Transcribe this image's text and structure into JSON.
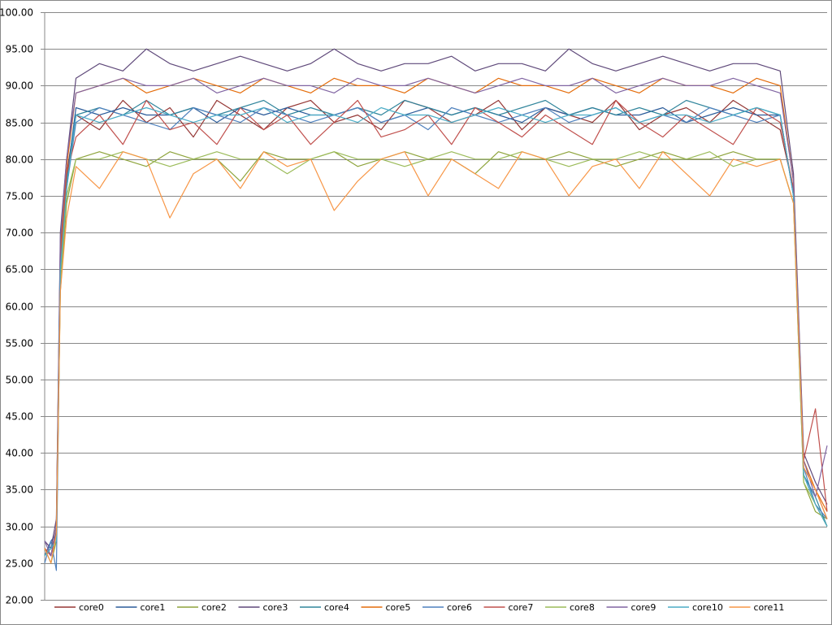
{
  "chart_data": {
    "type": "line",
    "title": "",
    "xlabel": "",
    "ylabel": "",
    "ylim": [
      20,
      100
    ],
    "yticks": [
      "20.00",
      "25.00",
      "30.00",
      "35.00",
      "40.00",
      "45.00",
      "50.00",
      "55.00",
      "60.00",
      "65.00",
      "70.00",
      "75.00",
      "80.00",
      "85.00",
      "90.00",
      "95.00",
      "100.00"
    ],
    "xlim": [
      0,
      1000
    ],
    "grid": true,
    "legend": "bottom",
    "x": [
      0,
      8,
      15,
      20,
      28,
      40,
      70,
      100,
      130,
      160,
      190,
      220,
      250,
      280,
      310,
      340,
      370,
      400,
      430,
      460,
      490,
      520,
      550,
      580,
      610,
      640,
      670,
      700,
      730,
      760,
      790,
      820,
      850,
      880,
      910,
      940,
      957,
      970,
      985,
      1000
    ],
    "series": [
      {
        "name": "core0",
        "color": "#953735",
        "values": [
          27,
          26,
          30,
          68,
          78,
          86,
          84,
          88,
          85,
          87,
          83,
          88,
          86,
          84,
          87,
          88,
          85,
          86,
          84,
          88,
          87,
          85,
          86,
          88,
          84,
          87,
          86,
          85,
          88,
          84,
          86,
          87,
          85,
          88,
          86,
          84,
          76,
          38,
          35,
          31
        ]
      },
      {
        "name": "core1",
        "color": "#2C5C9A",
        "values": [
          26,
          28,
          29,
          66,
          77,
          87,
          86,
          87,
          86,
          86,
          87,
          85,
          87,
          86,
          87,
          86,
          86,
          87,
          85,
          86,
          87,
          86,
          87,
          86,
          85,
          87,
          86,
          87,
          86,
          86,
          87,
          85,
          86,
          87,
          86,
          86,
          75,
          37,
          33,
          30
        ]
      },
      {
        "name": "core2",
        "color": "#8EA43C",
        "values": [
          27,
          25,
          28,
          62,
          74,
          80,
          81,
          80,
          79,
          81,
          80,
          80,
          77,
          81,
          80,
          80,
          81,
          79,
          80,
          81,
          80,
          80,
          78,
          81,
          80,
          80,
          81,
          80,
          79,
          80,
          81,
          80,
          80,
          81,
          80,
          80,
          74,
          36,
          32,
          31
        ]
      },
      {
        "name": "core3",
        "color": "#5F497A",
        "values": [
          28,
          27,
          31,
          70,
          80,
          91,
          93,
          92,
          95,
          93,
          92,
          93,
          94,
          93,
          92,
          93,
          95,
          93,
          92,
          93,
          93,
          94,
          92,
          93,
          93,
          92,
          95,
          93,
          92,
          93,
          94,
          93,
          92,
          93,
          93,
          92,
          78,
          40,
          36,
          33
        ]
      },
      {
        "name": "core4",
        "color": "#31859C",
        "values": [
          26,
          27,
          29,
          65,
          77,
          86,
          87,
          86,
          88,
          86,
          87,
          86,
          87,
          88,
          86,
          87,
          86,
          87,
          86,
          88,
          87,
          86,
          87,
          86,
          87,
          88,
          86,
          87,
          86,
          87,
          86,
          88,
          87,
          86,
          87,
          86,
          75,
          37,
          34,
          30
        ]
      },
      {
        "name": "core5",
        "color": "#E46C0A",
        "values": [
          27,
          26,
          30,
          67,
          79,
          89,
          90,
          91,
          89,
          90,
          91,
          90,
          89,
          91,
          90,
          89,
          91,
          90,
          90,
          89,
          91,
          90,
          89,
          91,
          90,
          90,
          89,
          91,
          90,
          89,
          91,
          90,
          90,
          89,
          91,
          90,
          77,
          39,
          35,
          32
        ]
      },
      {
        "name": "core6",
        "color": "#4F81BD",
        "values": [
          25,
          28,
          24,
          64,
          76,
          85,
          87,
          86,
          85,
          84,
          87,
          86,
          85,
          87,
          86,
          85,
          86,
          87,
          85,
          86,
          84,
          87,
          86,
          85,
          86,
          87,
          85,
          86,
          87,
          85,
          86,
          85,
          87,
          86,
          85,
          86,
          75,
          38,
          33,
          31
        ]
      },
      {
        "name": "core7",
        "color": "#C0504D",
        "values": [
          27,
          26,
          29,
          66,
          78,
          83,
          86,
          82,
          88,
          84,
          85,
          82,
          87,
          84,
          86,
          82,
          85,
          88,
          83,
          84,
          86,
          82,
          87,
          85,
          83,
          86,
          84,
          82,
          88,
          85,
          83,
          86,
          84,
          82,
          87,
          85,
          76,
          39,
          46,
          32
        ]
      },
      {
        "name": "core8",
        "color": "#9BBB59",
        "values": [
          26,
          27,
          28,
          63,
          75,
          80,
          80,
          81,
          80,
          79,
          80,
          81,
          80,
          80,
          78,
          80,
          81,
          80,
          80,
          79,
          80,
          81,
          80,
          80,
          81,
          80,
          79,
          80,
          80,
          81,
          80,
          80,
          81,
          79,
          80,
          80,
          74,
          36,
          33,
          30
        ]
      },
      {
        "name": "core9",
        "color": "#8064A2",
        "values": [
          28,
          26,
          30,
          69,
          80,
          89,
          90,
          91,
          90,
          90,
          91,
          89,
          90,
          91,
          90,
          90,
          89,
          91,
          90,
          90,
          91,
          90,
          89,
          90,
          91,
          90,
          90,
          91,
          89,
          90,
          91,
          90,
          90,
          91,
          90,
          89,
          77,
          39,
          34,
          41
        ]
      },
      {
        "name": "core10",
        "color": "#4BACC6",
        "values": [
          26,
          27,
          28,
          65,
          76,
          86,
          85,
          86,
          87,
          86,
          85,
          86,
          86,
          87,
          85,
          86,
          86,
          85,
          87,
          86,
          86,
          85,
          86,
          87,
          86,
          85,
          86,
          86,
          87,
          85,
          86,
          86,
          85,
          86,
          87,
          86,
          75,
          37,
          33,
          30
        ]
      },
      {
        "name": "core11",
        "color": "#F79646",
        "values": [
          27,
          25,
          29,
          62,
          72,
          79,
          76,
          81,
          80,
          72,
          78,
          80,
          76,
          81,
          79,
          80,
          73,
          77,
          80,
          81,
          75,
          80,
          78,
          76,
          81,
          80,
          75,
          79,
          80,
          76,
          81,
          78,
          75,
          80,
          79,
          80,
          74,
          38,
          35,
          31
        ]
      }
    ]
  }
}
